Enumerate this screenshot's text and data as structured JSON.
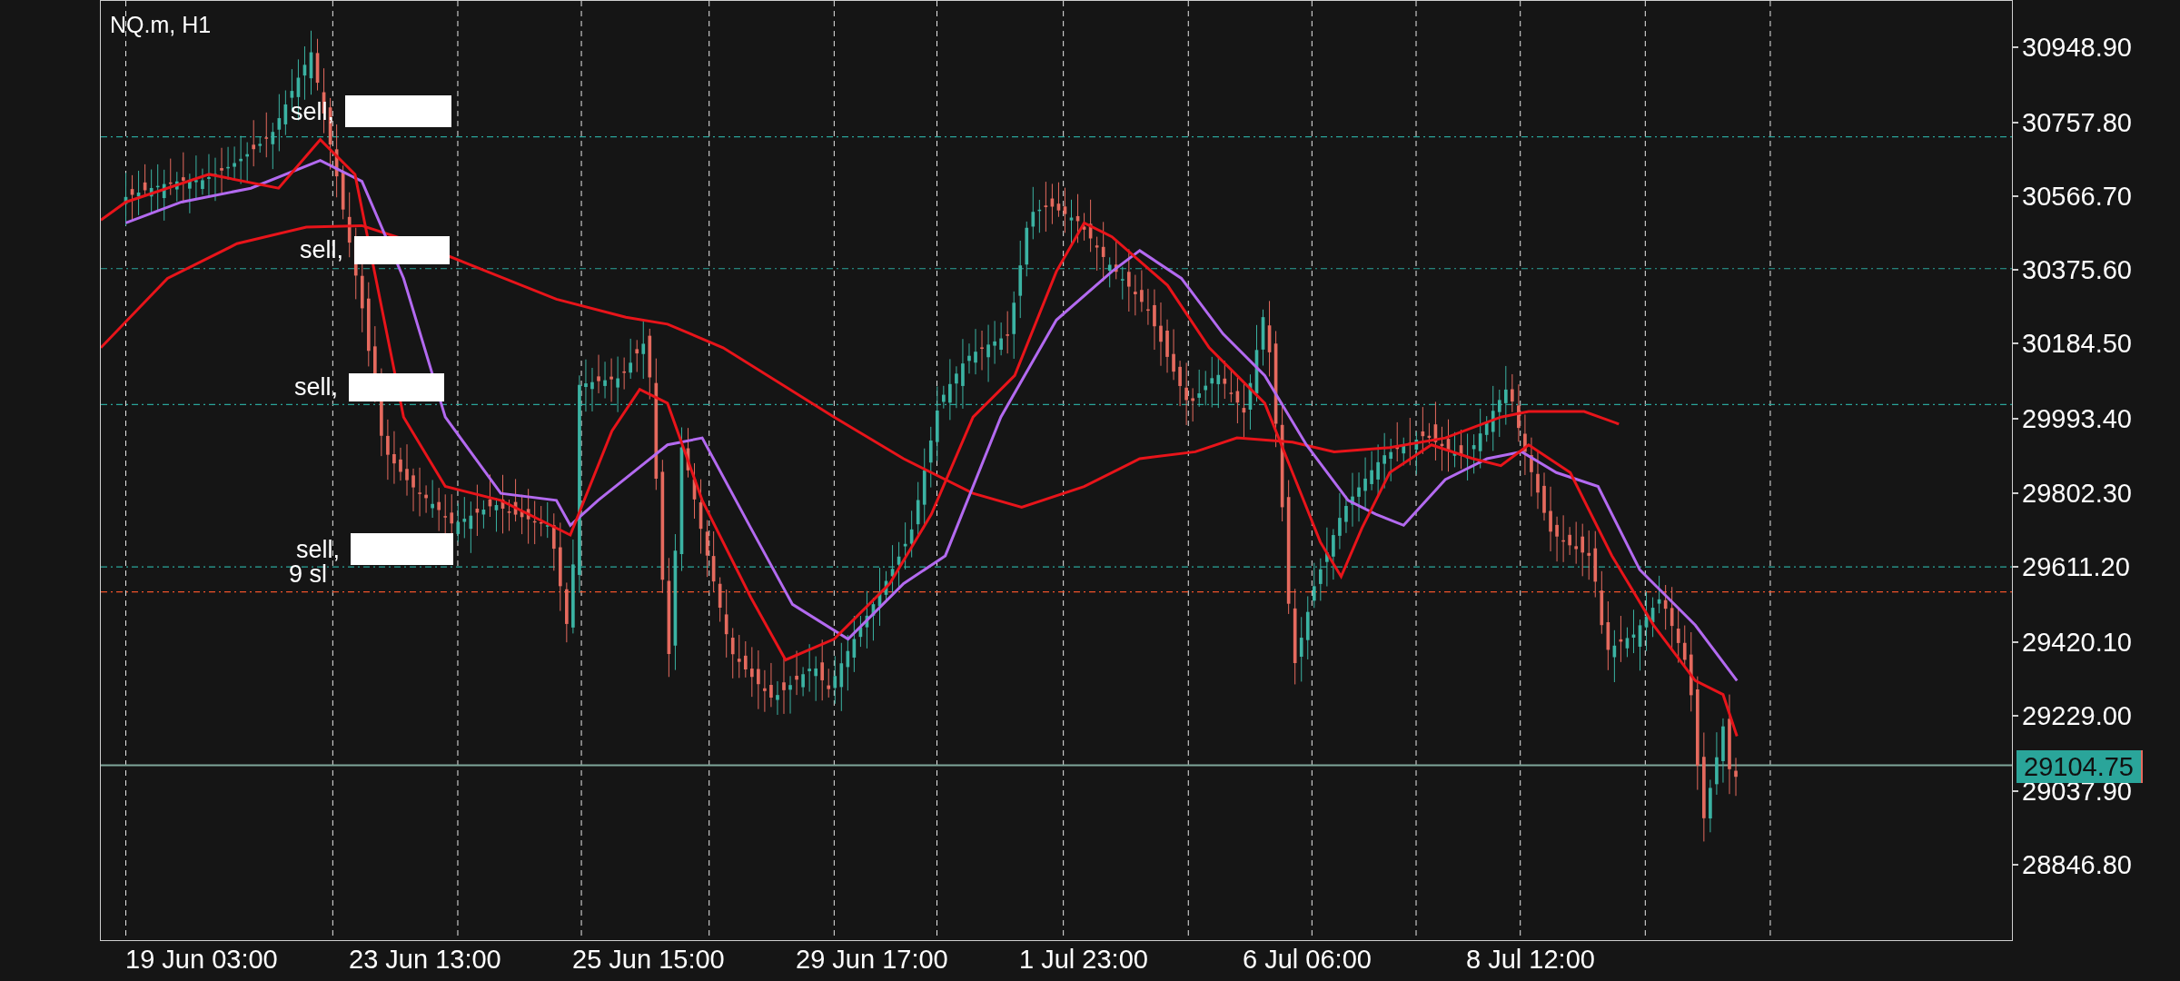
{
  "chart": {
    "title": "NQ.m, H1",
    "order_labels": [
      {
        "text": "sell,",
        "redacted": true
      },
      {
        "text": "sell,",
        "redacted": true
      },
      {
        "text": "sell,",
        "redacted": true
      },
      {
        "text": "sell,",
        "redacted": true
      },
      {
        "text": "9 sl",
        "redacted": false
      }
    ],
    "price_axis": [
      "30948.90",
      "30757.80",
      "30566.70",
      "30375.60",
      "30184.50",
      "29993.40",
      "29802.30",
      "29611.20",
      "29420.10",
      "29229.00",
      "29037.90",
      "28846.80"
    ],
    "current_price": "29104.75",
    "time_axis": [
      "19 Jun 03:00",
      "23 Jun 13:00",
      "25 Jun 15:00",
      "29 Jun 17:00",
      "1 Jul 23:00",
      "6 Jul 06:00",
      "8 Jul 12:00"
    ]
  }
}
